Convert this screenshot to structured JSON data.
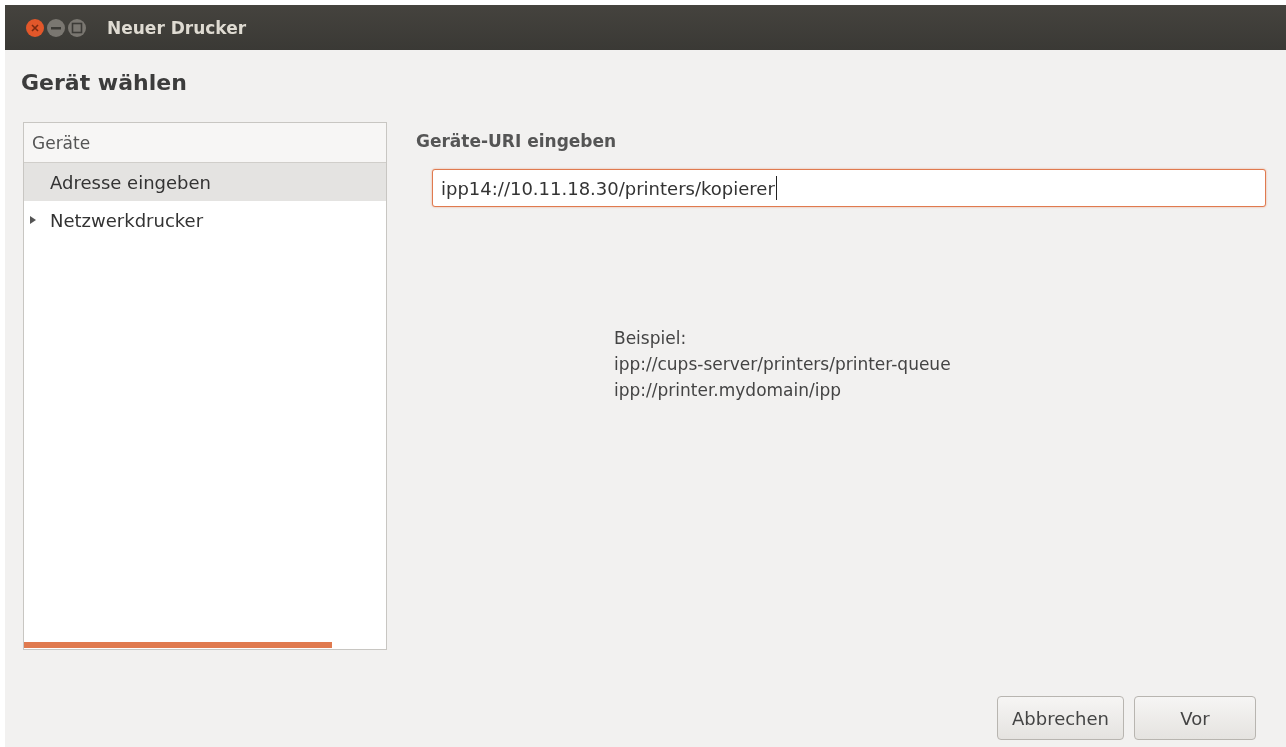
{
  "window": {
    "title": "Neuer Drucker"
  },
  "heading": "Gerät wählen",
  "devices": {
    "column": "Geräte",
    "items": [
      {
        "label": "Adresse eingeben",
        "kind": "leaf",
        "selected": true
      },
      {
        "label": "Netzwerkdrucker",
        "kind": "group",
        "selected": false,
        "expanded": false
      }
    ],
    "progress": {
      "level": 0.85
    }
  },
  "uri": {
    "label": "Geräte-URI eingeben",
    "value": "ipp14://10.11.18.30/printers/kopierer"
  },
  "example": [
    "Beispiel:",
    "ipp://cups-server/printers/printer-queue",
    "ipp://printer.mydomain/ipp"
  ],
  "buttons": [
    "Abbrechen",
    "Vor"
  ]
}
